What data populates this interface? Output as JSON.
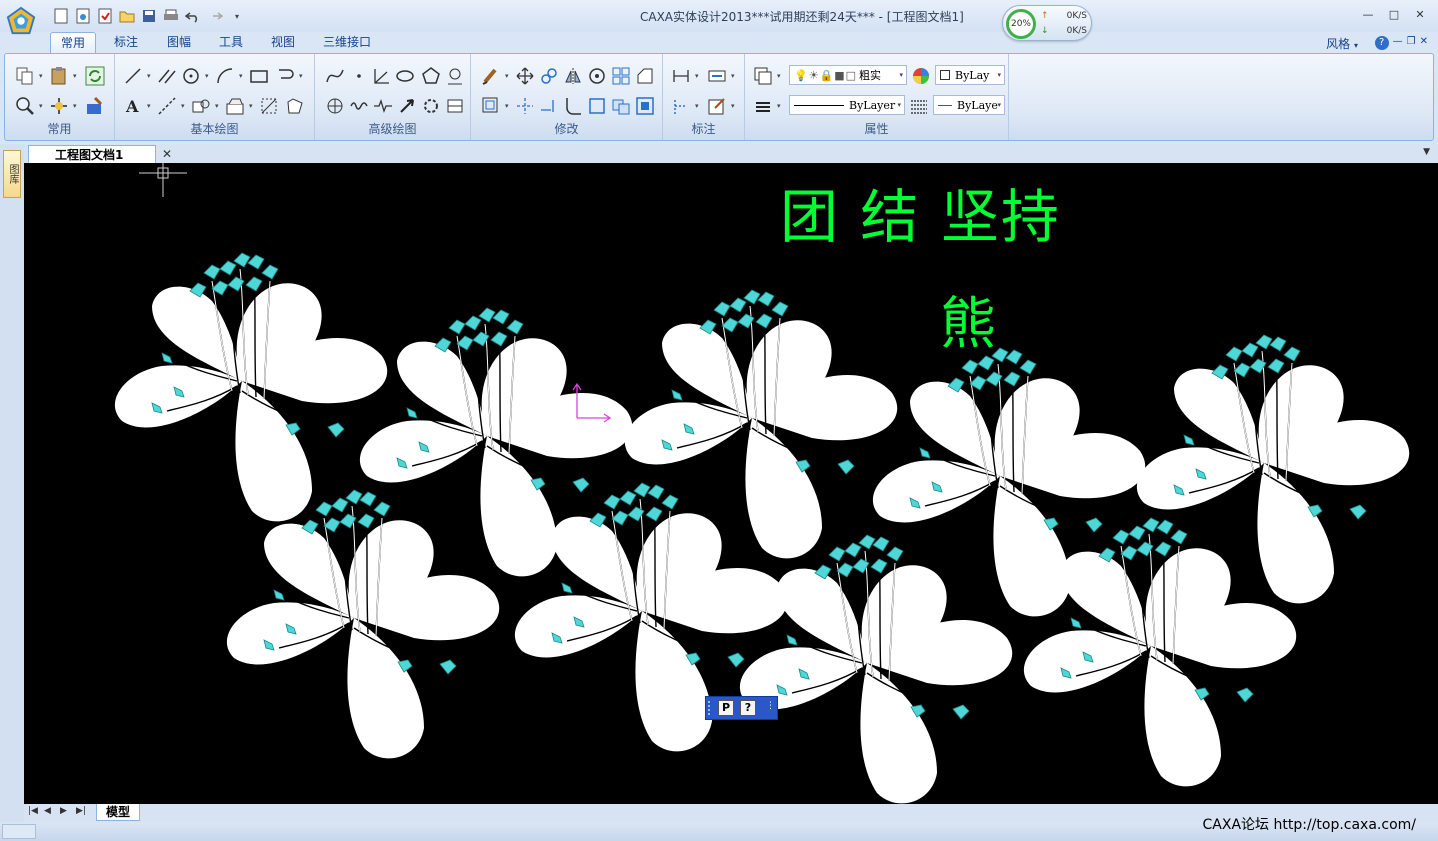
{
  "window": {
    "title": "CAXA实体设计2013***试用期还剩24天*** - [工程图文档1]",
    "style_menu": "风格"
  },
  "net_widget": {
    "percent": "20%",
    "upload": "0K/S",
    "download": "0K/S"
  },
  "ribbon_tabs": [
    "常用",
    "标注",
    "图幅",
    "工具",
    "视图",
    "三维接口"
  ],
  "ribbon_groups": {
    "common": "常用",
    "basic_draw": "基本绘图",
    "advanced_draw": "高级绘图",
    "modify": "修改",
    "annotate": "标注",
    "properties": "属性"
  },
  "properties": {
    "layer_name": "粗实",
    "color_combo": "ByLay",
    "linetype_combo": "ByLayer",
    "lineweight_combo": "ByLaye"
  },
  "document_tab": "工程图文档1",
  "layer_panel_tab": "图库",
  "drawing": {
    "title_text": "团 结 坚持",
    "author_text": "熊"
  },
  "sheet_tab": "模型",
  "forum_text": "CAXA论坛 http://top.caxa.com/",
  "float_toolbar": {
    "btn1": "P",
    "btn2": "?"
  },
  "colors": {
    "canvas": "#000000",
    "text_green": "#00ff33",
    "stamen_cyan": "#4fd6d6",
    "ucs_magenta": "#e040e0",
    "float_toolbar": "#2a58c8"
  }
}
